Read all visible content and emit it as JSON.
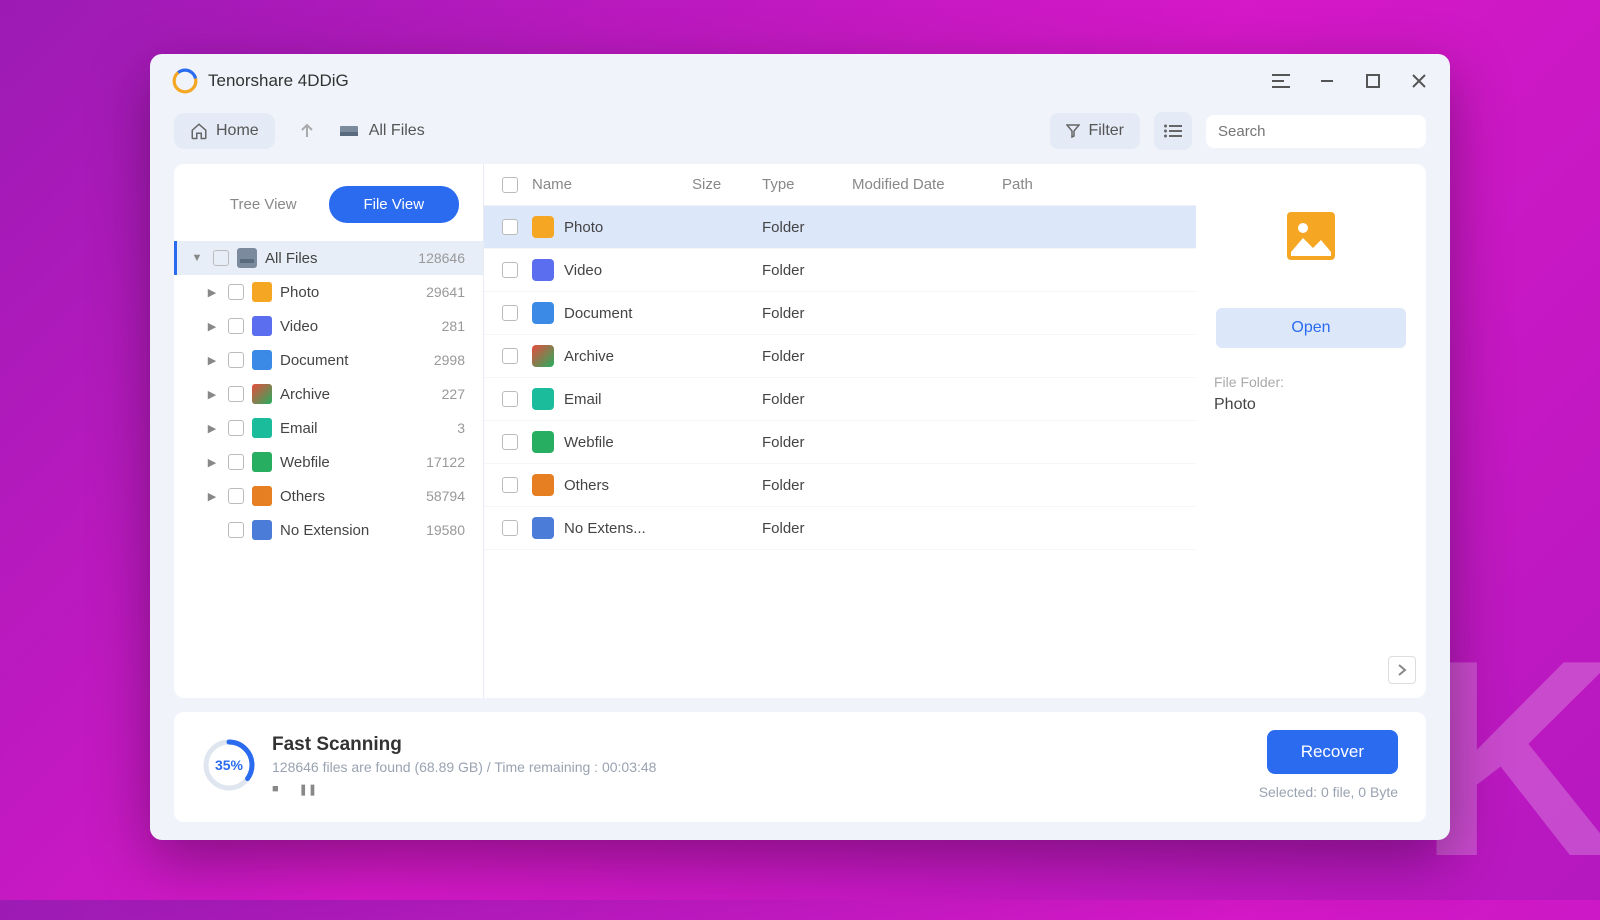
{
  "app": {
    "title": "Tenorshare 4DDiG"
  },
  "toolbar": {
    "home_label": "Home",
    "breadcrumb": "All Files",
    "filter_label": "Filter",
    "search_placeholder": "Search"
  },
  "views": {
    "tree_label": "Tree View",
    "file_label": "File View"
  },
  "tree": {
    "root": {
      "label": "All Files",
      "count": "128646"
    },
    "items": [
      {
        "label": "Photo",
        "count": "29641",
        "icon": "ic-photo"
      },
      {
        "label": "Video",
        "count": "281",
        "icon": "ic-video"
      },
      {
        "label": "Document",
        "count": "2998",
        "icon": "ic-doc"
      },
      {
        "label": "Archive",
        "count": "227",
        "icon": "ic-archive"
      },
      {
        "label": "Email",
        "count": "3",
        "icon": "ic-email"
      },
      {
        "label": "Webfile",
        "count": "17122",
        "icon": "ic-web"
      },
      {
        "label": "Others",
        "count": "58794",
        "icon": "ic-others"
      },
      {
        "label": "No Extension",
        "count": "19580",
        "icon": "ic-noext"
      }
    ]
  },
  "columns": {
    "name": "Name",
    "size": "Size",
    "type": "Type",
    "modified": "Modified Date",
    "path": "Path"
  },
  "rows": [
    {
      "name": "Photo",
      "type": "Folder",
      "icon": "ic-photo",
      "selected": true
    },
    {
      "name": "Video",
      "type": "Folder",
      "icon": "ic-video"
    },
    {
      "name": "Document",
      "type": "Folder",
      "icon": "ic-doc"
    },
    {
      "name": "Archive",
      "type": "Folder",
      "icon": "ic-archive"
    },
    {
      "name": "Email",
      "type": "Folder",
      "icon": "ic-email"
    },
    {
      "name": "Webfile",
      "type": "Folder",
      "icon": "ic-web"
    },
    {
      "name": "Others",
      "type": "Folder",
      "icon": "ic-others"
    },
    {
      "name": "No Extens...",
      "type": "Folder",
      "icon": "ic-noext"
    }
  ],
  "preview": {
    "open_label": "Open",
    "folder_label": "File Folder:",
    "folder_value": "Photo"
  },
  "footer": {
    "percent": "35%",
    "percent_num": 35,
    "title": "Fast Scanning",
    "subtitle": "128646 files are found (68.89 GB)  /   Time remaining : 00:03:48",
    "recover_label": "Recover",
    "selected_text": "Selected: 0 file, 0 Byte"
  }
}
